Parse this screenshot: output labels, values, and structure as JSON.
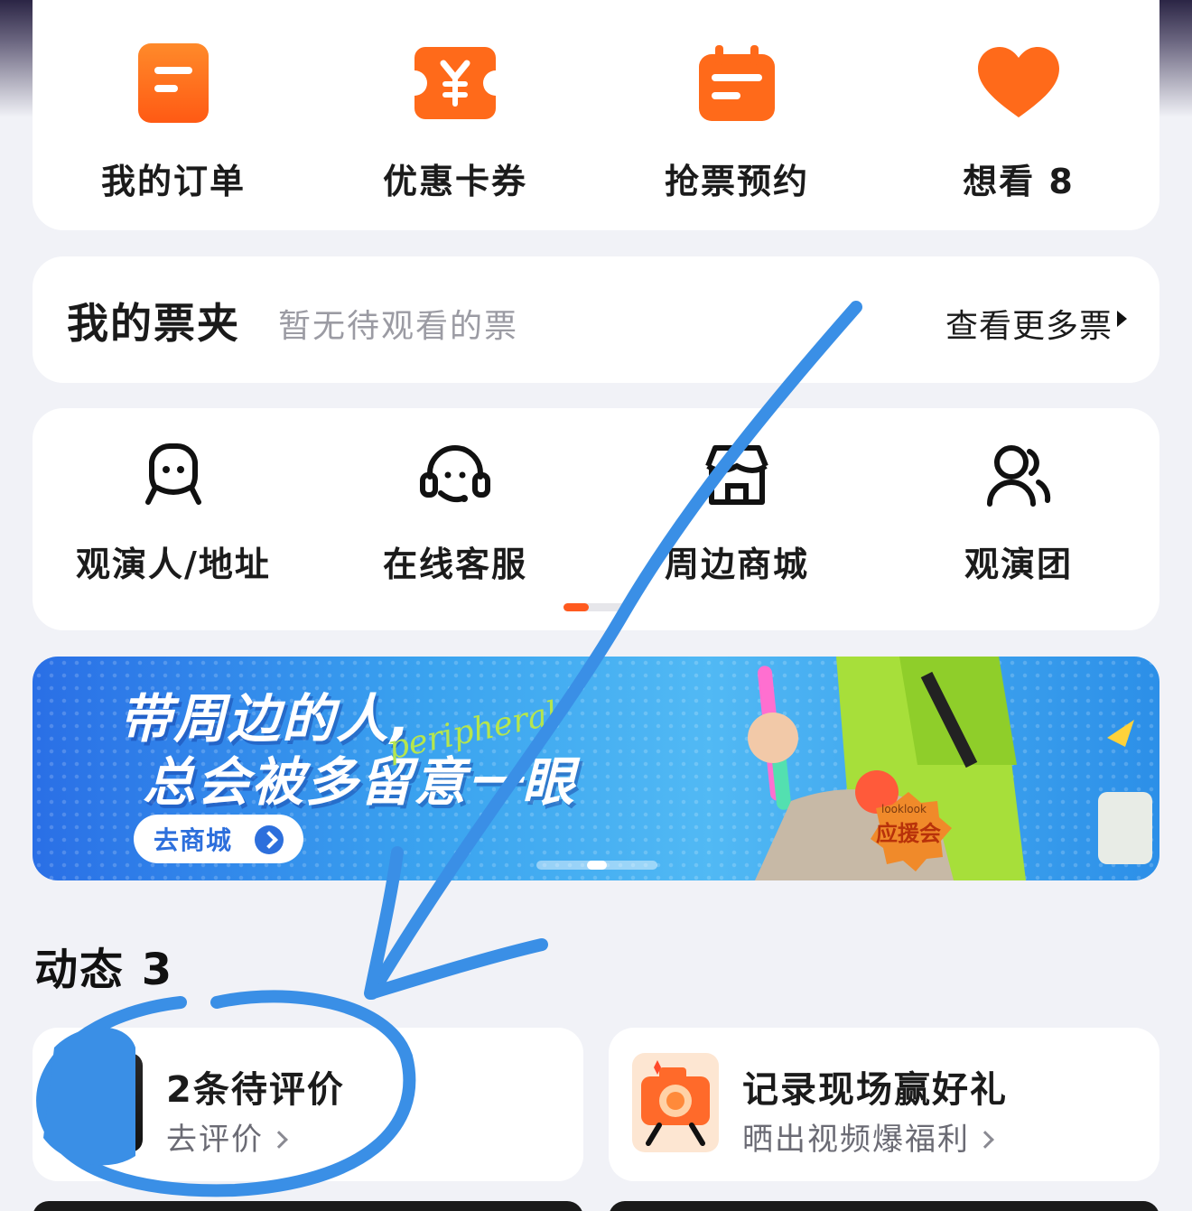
{
  "quick_actions": [
    {
      "label": "我的订单",
      "icon": "orders-icon"
    },
    {
      "label": "优惠卡券",
      "icon": "coupon-icon"
    },
    {
      "label": "抢票预约",
      "icon": "calendar-icon"
    },
    {
      "label": "想看 8",
      "icon": "heart-icon"
    }
  ],
  "ticket_folder": {
    "title": "我的票夹",
    "subtitle": "暂无待观看的票",
    "more": "查看更多票"
  },
  "services": [
    {
      "label": "观演人/地址",
      "icon": "viewer-icon"
    },
    {
      "label": "在线客服",
      "icon": "headset-icon"
    },
    {
      "label": "周边商城",
      "icon": "store-icon"
    },
    {
      "label": "观演团",
      "icon": "group-icon"
    }
  ],
  "banner": {
    "line1": "带周边的人,",
    "line2": "总会被多留意一眼",
    "script": "peripheral",
    "button": "去商城",
    "badge_top": "looklook",
    "badge_main": "应援会"
  },
  "feed": {
    "title": "动态 3",
    "review": {
      "title": "2条待评价",
      "action": "去评价"
    },
    "record": {
      "title": "记录现场赢好礼",
      "action": "晒出视频爆福利"
    }
  },
  "colors": {
    "accent_orange": "#ff6a1a",
    "annotation_blue": "#3a8fe6"
  }
}
